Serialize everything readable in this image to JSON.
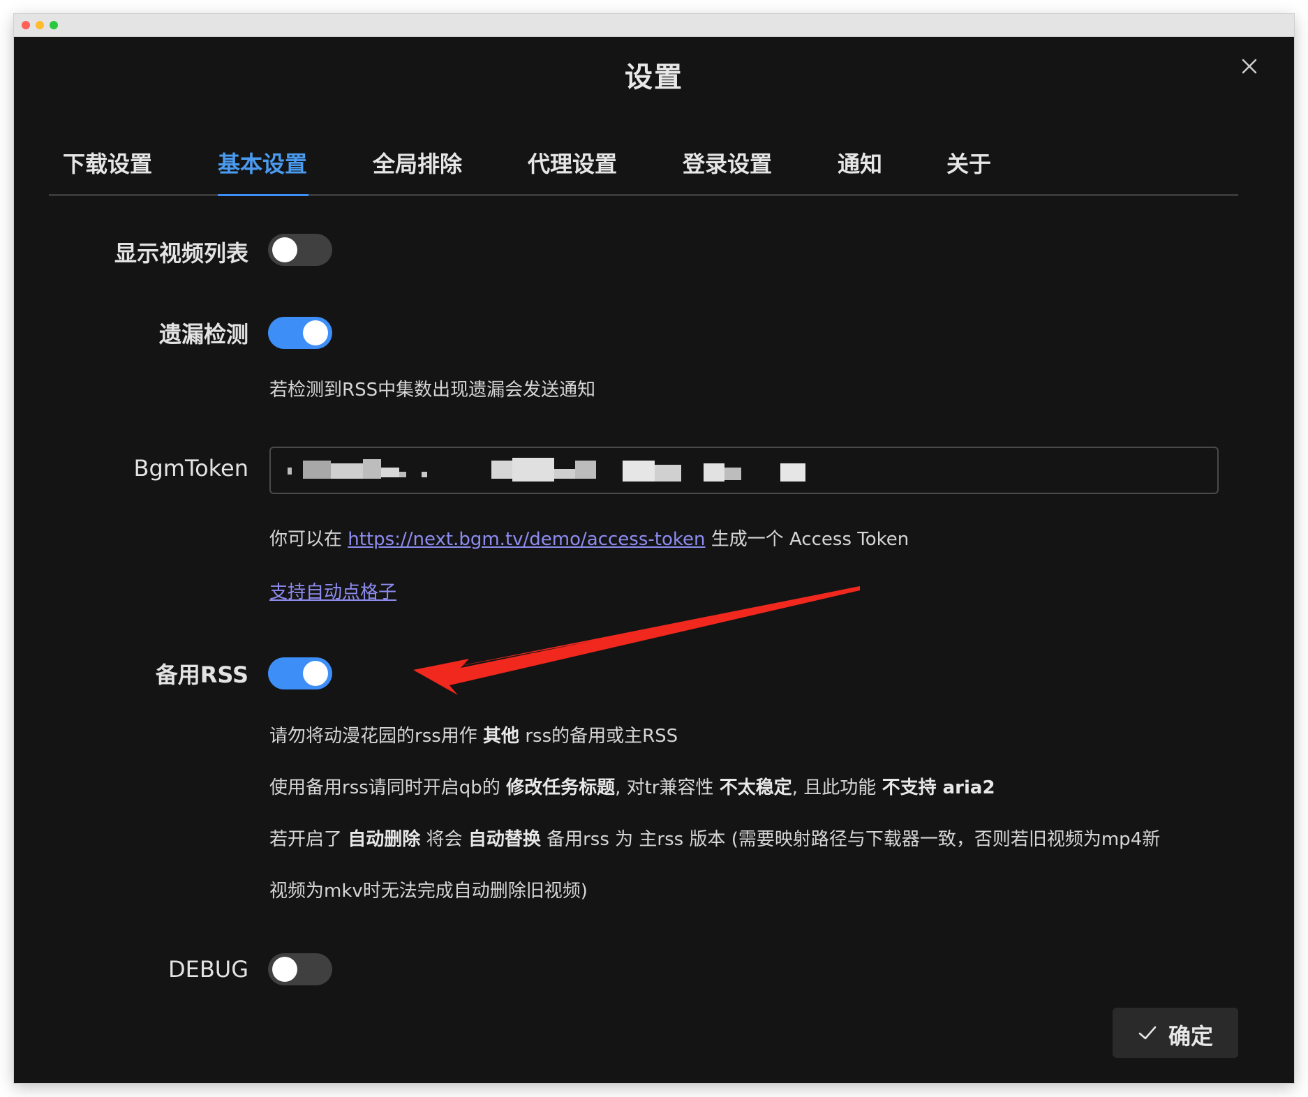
{
  "window": {
    "title": "设置"
  },
  "tabs": [
    {
      "label": "下载设置"
    },
    {
      "label": "基本设置",
      "active": true
    },
    {
      "label": "全局排除"
    },
    {
      "label": "代理设置"
    },
    {
      "label": "登录设置"
    },
    {
      "label": "通知"
    },
    {
      "label": "关于"
    }
  ],
  "settings": {
    "show_video_list": {
      "label": "显示视频列表",
      "enabled": false
    },
    "missing_check": {
      "label": "遗漏检测",
      "enabled": true,
      "help": "若检测到RSS中集数出现遗漏会发送通知"
    },
    "bgm_token": {
      "label": "BgmToken",
      "help_prefix": "你可以在",
      "help_link": "https://next.bgm.tv/demo/access-token",
      "help_suffix": "生成一个 Access Token",
      "extra_link": "支持自动点格子"
    },
    "backup_rss": {
      "label": "备用RSS",
      "enabled": true,
      "line1_a": "请勿将动漫花园的rss用作 ",
      "line1_b": "其他",
      "line1_c": " rss的备用或主RSS",
      "line2_a": "使用备用rss请同时开启qb的 ",
      "line2_b": "修改任务标题",
      "line2_c": ", 对tr兼容性 ",
      "line2_d": "不太稳定",
      "line2_e": ", 且此功能 ",
      "line2_f": "不支持 aria2",
      "line3_a": "若开启了 ",
      "line3_b": "自动删除",
      "line3_c": " 将会 ",
      "line3_d": "自动替换",
      "line3_e": " 备用rss 为 主rss 版本 (需要映射路径与下载器一致，否则若旧视频为mp4新",
      "line4": "视频为mkv时无法完成自动删除旧视频)"
    },
    "debug": {
      "label": "DEBUG",
      "enabled": false
    }
  },
  "footer": {
    "confirm_label": "确定"
  },
  "colors": {
    "background": "#141414",
    "accent": "#3e8ef7",
    "active_tab": "#4a9bef",
    "link": "#8e8cf0",
    "annotation_arrow": "#f0281e"
  },
  "icons": [
    "close-icon",
    "check-icon",
    "annotation-arrow"
  ]
}
